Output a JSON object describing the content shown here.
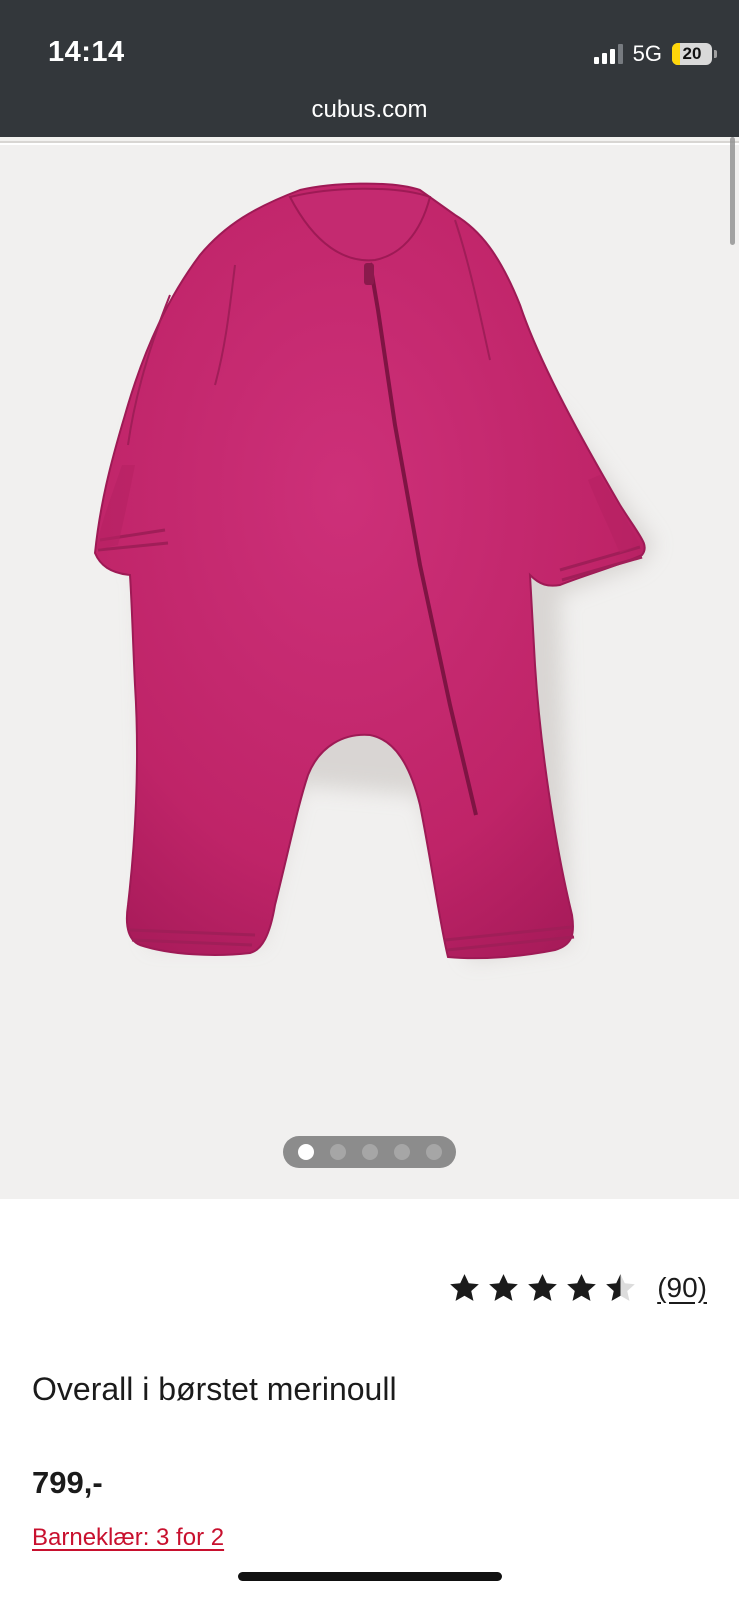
{
  "status_bar": {
    "time": "14:14",
    "network": "5G",
    "battery": "20",
    "battery_fraction": 0.2,
    "signal_bars_active": 3,
    "signal_bars_total": 4
  },
  "browser": {
    "url": "cubus.com"
  },
  "gallery": {
    "image_count": 5,
    "active_index": 0,
    "product_color": "#c0236a"
  },
  "product": {
    "rating_value": 4.5,
    "rating_max": 5,
    "rating_count": "(90)",
    "title": "Overall i børstet merinoull",
    "price": "799,-",
    "promo": "Barneklær: 3 for 2"
  },
  "colors": {
    "header_bg": "#33373b",
    "promo": "#c8102e",
    "star": "#1b1b1b"
  }
}
